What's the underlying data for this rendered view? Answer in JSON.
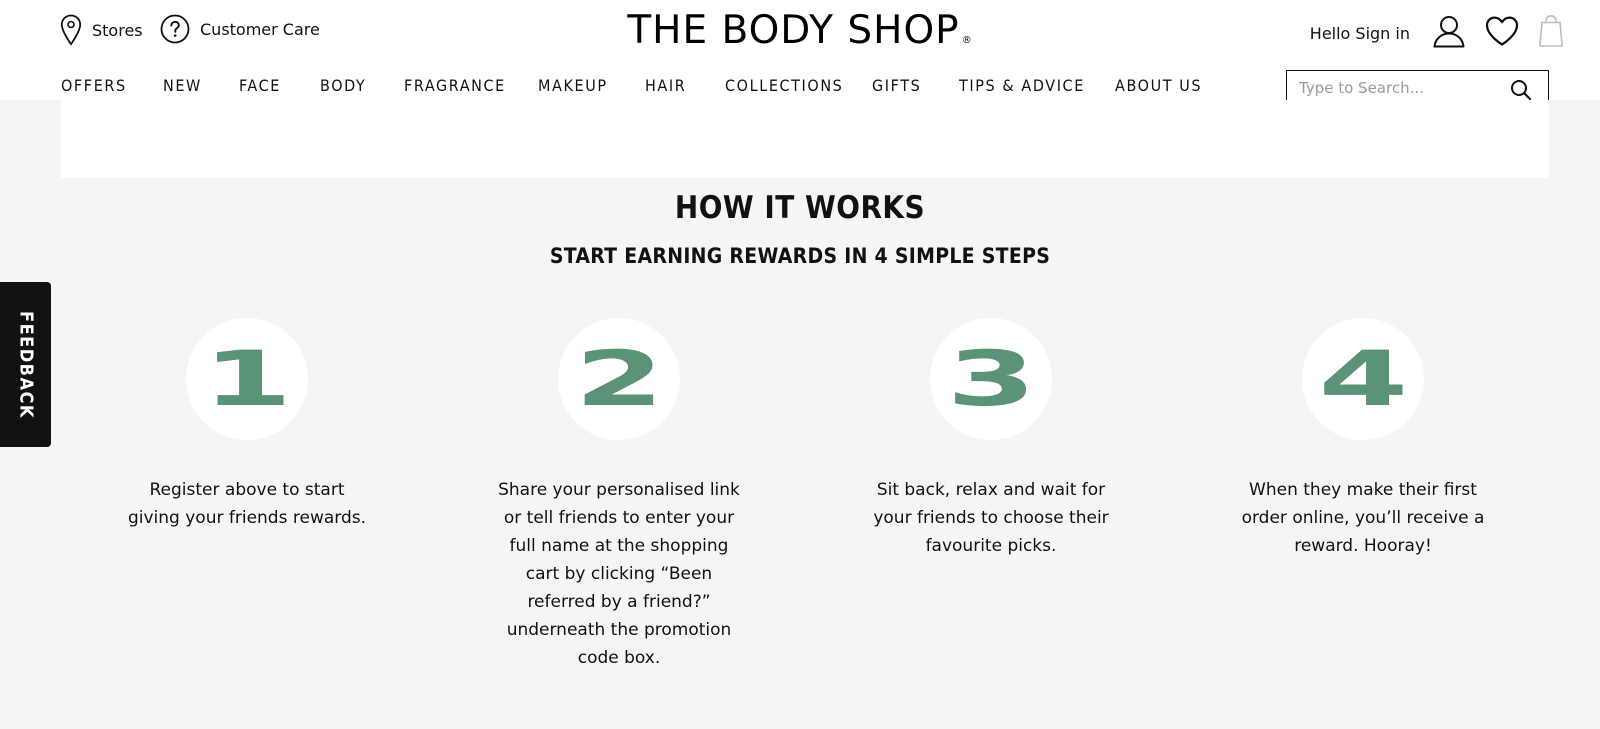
{
  "header": {
    "stores_label": "Stores",
    "care_label": "Customer Care",
    "logo_text": "THE BODY SHOP",
    "logo_mark": "®",
    "signin_label": "Hello Sign in"
  },
  "nav": {
    "items": [
      "OFFERS",
      "NEW",
      "FACE",
      "BODY",
      "FRAGRANCE",
      "MAKEUP",
      "HAIR",
      "COLLECTIONS",
      "GIFTS",
      "TIPS & ADVICE",
      "ABOUT US"
    ]
  },
  "search": {
    "placeholder": "Type to Search..."
  },
  "main": {
    "title": "HOW IT WORKS",
    "subtitle": "START EARNING REWARDS IN 4 SIMPLE STEPS",
    "steps": [
      {
        "number": "1",
        "text": "Register above to start giving your friends rewards."
      },
      {
        "number": "2",
        "text": "Share your personalised link or tell friends to enter your full name at the shopping cart by clicking “Been referred by a friend?” underneath the promotion code box."
      },
      {
        "number": "3",
        "text": "Sit back, relax and wait for your friends to choose their favourite picks."
      },
      {
        "number": "4",
        "text": "When they make their first order online, you’ll receive a reward. Hooray!"
      }
    ]
  },
  "feedback": {
    "label": "FEEDBACK"
  },
  "colors": {
    "accent": "#5a9375",
    "ink": "#111111",
    "background": "#f5f5f5"
  },
  "icons": [
    "map-pin-icon",
    "question-icon",
    "user-icon",
    "heart-icon",
    "shopping-bag-icon",
    "search-icon"
  ]
}
